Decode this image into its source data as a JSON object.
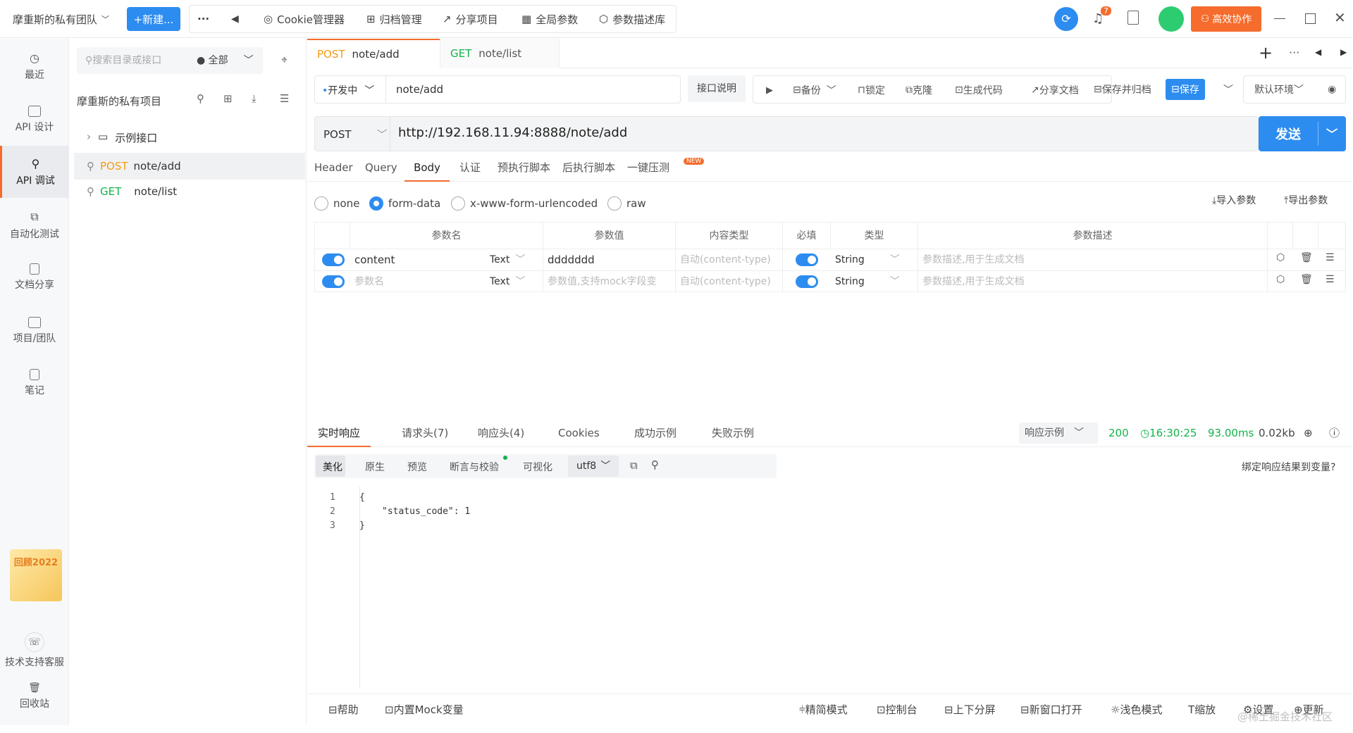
{
  "topbar": {
    "team": "摩重斯的私有团队",
    "new_btn": "+新建...",
    "more": "···",
    "back": "◀",
    "cookie": "Cookie管理器",
    "archive": "归档管理",
    "share": "分享项目",
    "global": "全局参数",
    "param_lib": "参数描述库",
    "badge": "7",
    "collab": "高效协作",
    "colors": {
      "accent": "#2d8cf0",
      "orange": "#f56c2d"
    }
  },
  "sidebar": {
    "items": [
      {
        "label": "最近",
        "icon": "clock-icon"
      },
      {
        "label": "API 设计",
        "icon": "edit-icon"
      },
      {
        "label": "API 调试",
        "icon": "link-icon"
      },
      {
        "label": "自动化测试",
        "icon": "flow-icon"
      },
      {
        "label": "文档分享",
        "icon": "doc-icon"
      },
      {
        "label": "项目/团队",
        "icon": "folder-icon"
      },
      {
        "label": "笔记",
        "icon": "note-icon"
      }
    ],
    "support": "技术支持客服",
    "trash": "回收站",
    "promo": "回顾2022"
  },
  "tree": {
    "search_placeholder": "搜索目录或接口",
    "filter": "全部",
    "project": "摩重斯的私有项目",
    "folder": "示例接口",
    "items": [
      {
        "method": "POST",
        "path": "note/add"
      },
      {
        "method": "GET",
        "path": "note/list"
      }
    ]
  },
  "tabs": [
    {
      "method": "POST",
      "path": "note/add"
    },
    {
      "method": "GET",
      "path": "note/list"
    }
  ],
  "toolbar": {
    "status": "开发中",
    "name": "note/add",
    "desc_btn": "接口说明",
    "run": "▶",
    "backup": "备份",
    "lock": "锁定",
    "clone": "克隆",
    "gencode": "生成代码",
    "sharedoc": "分享文档",
    "savearchive": "保存并归档",
    "save": "保存",
    "env": "默认环境"
  },
  "request": {
    "method": "POST",
    "url": "http://192.168.11.94:8888/note/add",
    "send": "发送"
  },
  "subtabs": [
    "Header",
    "Query",
    "Body",
    "认证",
    "预执行脚本",
    "后执行脚本",
    "一键压测"
  ],
  "new_badge": "NEW",
  "body_types": {
    "none": "none",
    "form": "form-data",
    "urlenc": "x-www-form-urlencoded",
    "raw": "raw"
  },
  "import": "导入参数",
  "export": "导出参数",
  "table": {
    "headers": [
      "参数名",
      "参数值",
      "内容类型",
      "必填",
      "类型",
      "参数描述"
    ],
    "rows": [
      {
        "name": "content",
        "ftype": "Text",
        "value": "ddddddd",
        "ctype": "自动(content-type)",
        "dtype": "String",
        "desc": "参数描述,用于生成文档"
      },
      {
        "name": "参数名",
        "ftype": "Text",
        "value": "参数值,支持mock字段变",
        "ctype": "自动(content-type)",
        "dtype": "String",
        "desc": "参数描述,用于生成文档"
      }
    ]
  },
  "response": {
    "tabs": [
      "实时响应",
      "请求头(7)",
      "响应头(4)",
      "Cookies",
      "成功示例",
      "失败示例"
    ],
    "example": "响应示例",
    "status": "200",
    "time": "16:30:25",
    "duration": "93.00ms",
    "size": "0.02kb",
    "views": [
      "美化",
      "原生",
      "预览",
      "断言与校验",
      "可视化"
    ],
    "encoding": "utf8",
    "bind": "绑定响应结果到变量?",
    "lines": [
      "1",
      "2",
      "3"
    ],
    "code": [
      "{",
      "\"status_code\": 1",
      "}"
    ]
  },
  "bottom": {
    "help": "帮助",
    "mock": "内置Mock变量",
    "simple": "精简模式",
    "console": "控制台",
    "split": "上下分屏",
    "newwin": "新窗口打开",
    "light": "浅色模式",
    "zoom": "缩放",
    "settings": "设置",
    "update": "更新",
    "watermark": "@稀土掘金技术社区"
  }
}
